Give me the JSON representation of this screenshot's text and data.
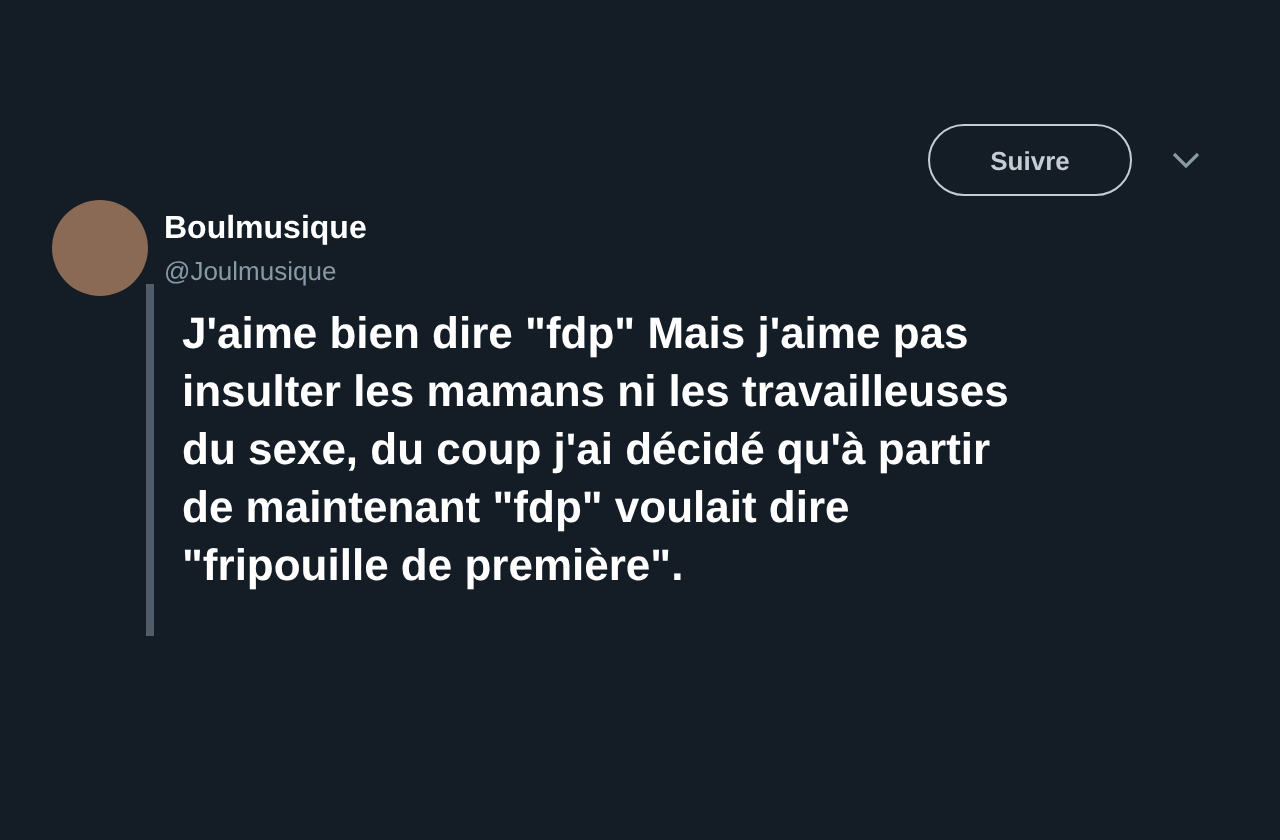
{
  "follow_button": {
    "label": "Suivre"
  },
  "author": {
    "name": "Boulmusique",
    "handle": "@Joulmusique"
  },
  "tweet": {
    "text": "J'aime bien dire \"fdp\" Mais j'aime pas\ninsulter les mamans ni les travailleuses\ndu sexe, du coup j'ai décidé qu'à partir\nde maintenant \"fdp\" voulait dire\n\"fripouille de première\"."
  }
}
